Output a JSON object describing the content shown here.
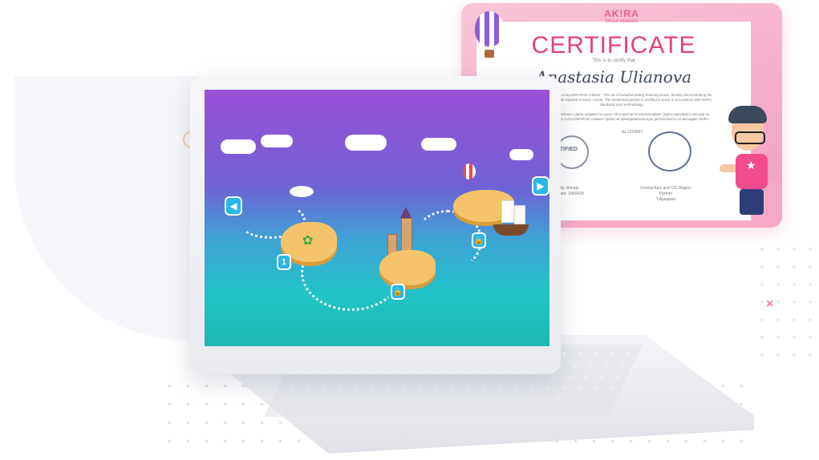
{
  "certificate": {
    "logo": "AK!RA",
    "logo_sub": "SPEED READING",
    "title": "CERTIFICATE",
    "subtitle": "This is to certify that",
    "name": "Anastasia Ulianova",
    "body_en": "fully passed AKIRA CALLIGRAPHIC 0 Block - The art of beautiful writing Teaching Exam, thereby demonstrating the knowledge and skills required to teach course. The mentioned person is certified to teach in accordance with AKIRA standards and methodology.",
    "body_ru": "по обучению и успешно сдала экзамен по курсу \"Инструктор по каллиграфии\" (курсы красивого письма) по программе AKIRA CALLIGRAPHIC и имеет право на преподавательскую деятельность по методике AKIRA",
    "number": "№ 1234567",
    "certified": "CERTIFIED",
    "city_label": "City:",
    "city": "Almaty",
    "date_label": "Date:",
    "date": "20/04/18",
    "partner": "Central Asia and CIS Region Partner",
    "partner_name": "T.Apsejeev"
  },
  "game": {
    "back_icon": "arrow-left-icon",
    "next_icon": "arrow-right-icon",
    "levels": [
      {
        "label": "1",
        "state": "unlocked"
      },
      {
        "label": "lock",
        "state": "locked"
      },
      {
        "label": "lock",
        "state": "locked"
      }
    ]
  },
  "decor": {
    "close_mark": "×"
  },
  "colors": {
    "accent": "#e5407c",
    "game_sky_top": "#9b4fd8",
    "game_sea": "#21c4c6",
    "button": "#2ab6e8"
  }
}
